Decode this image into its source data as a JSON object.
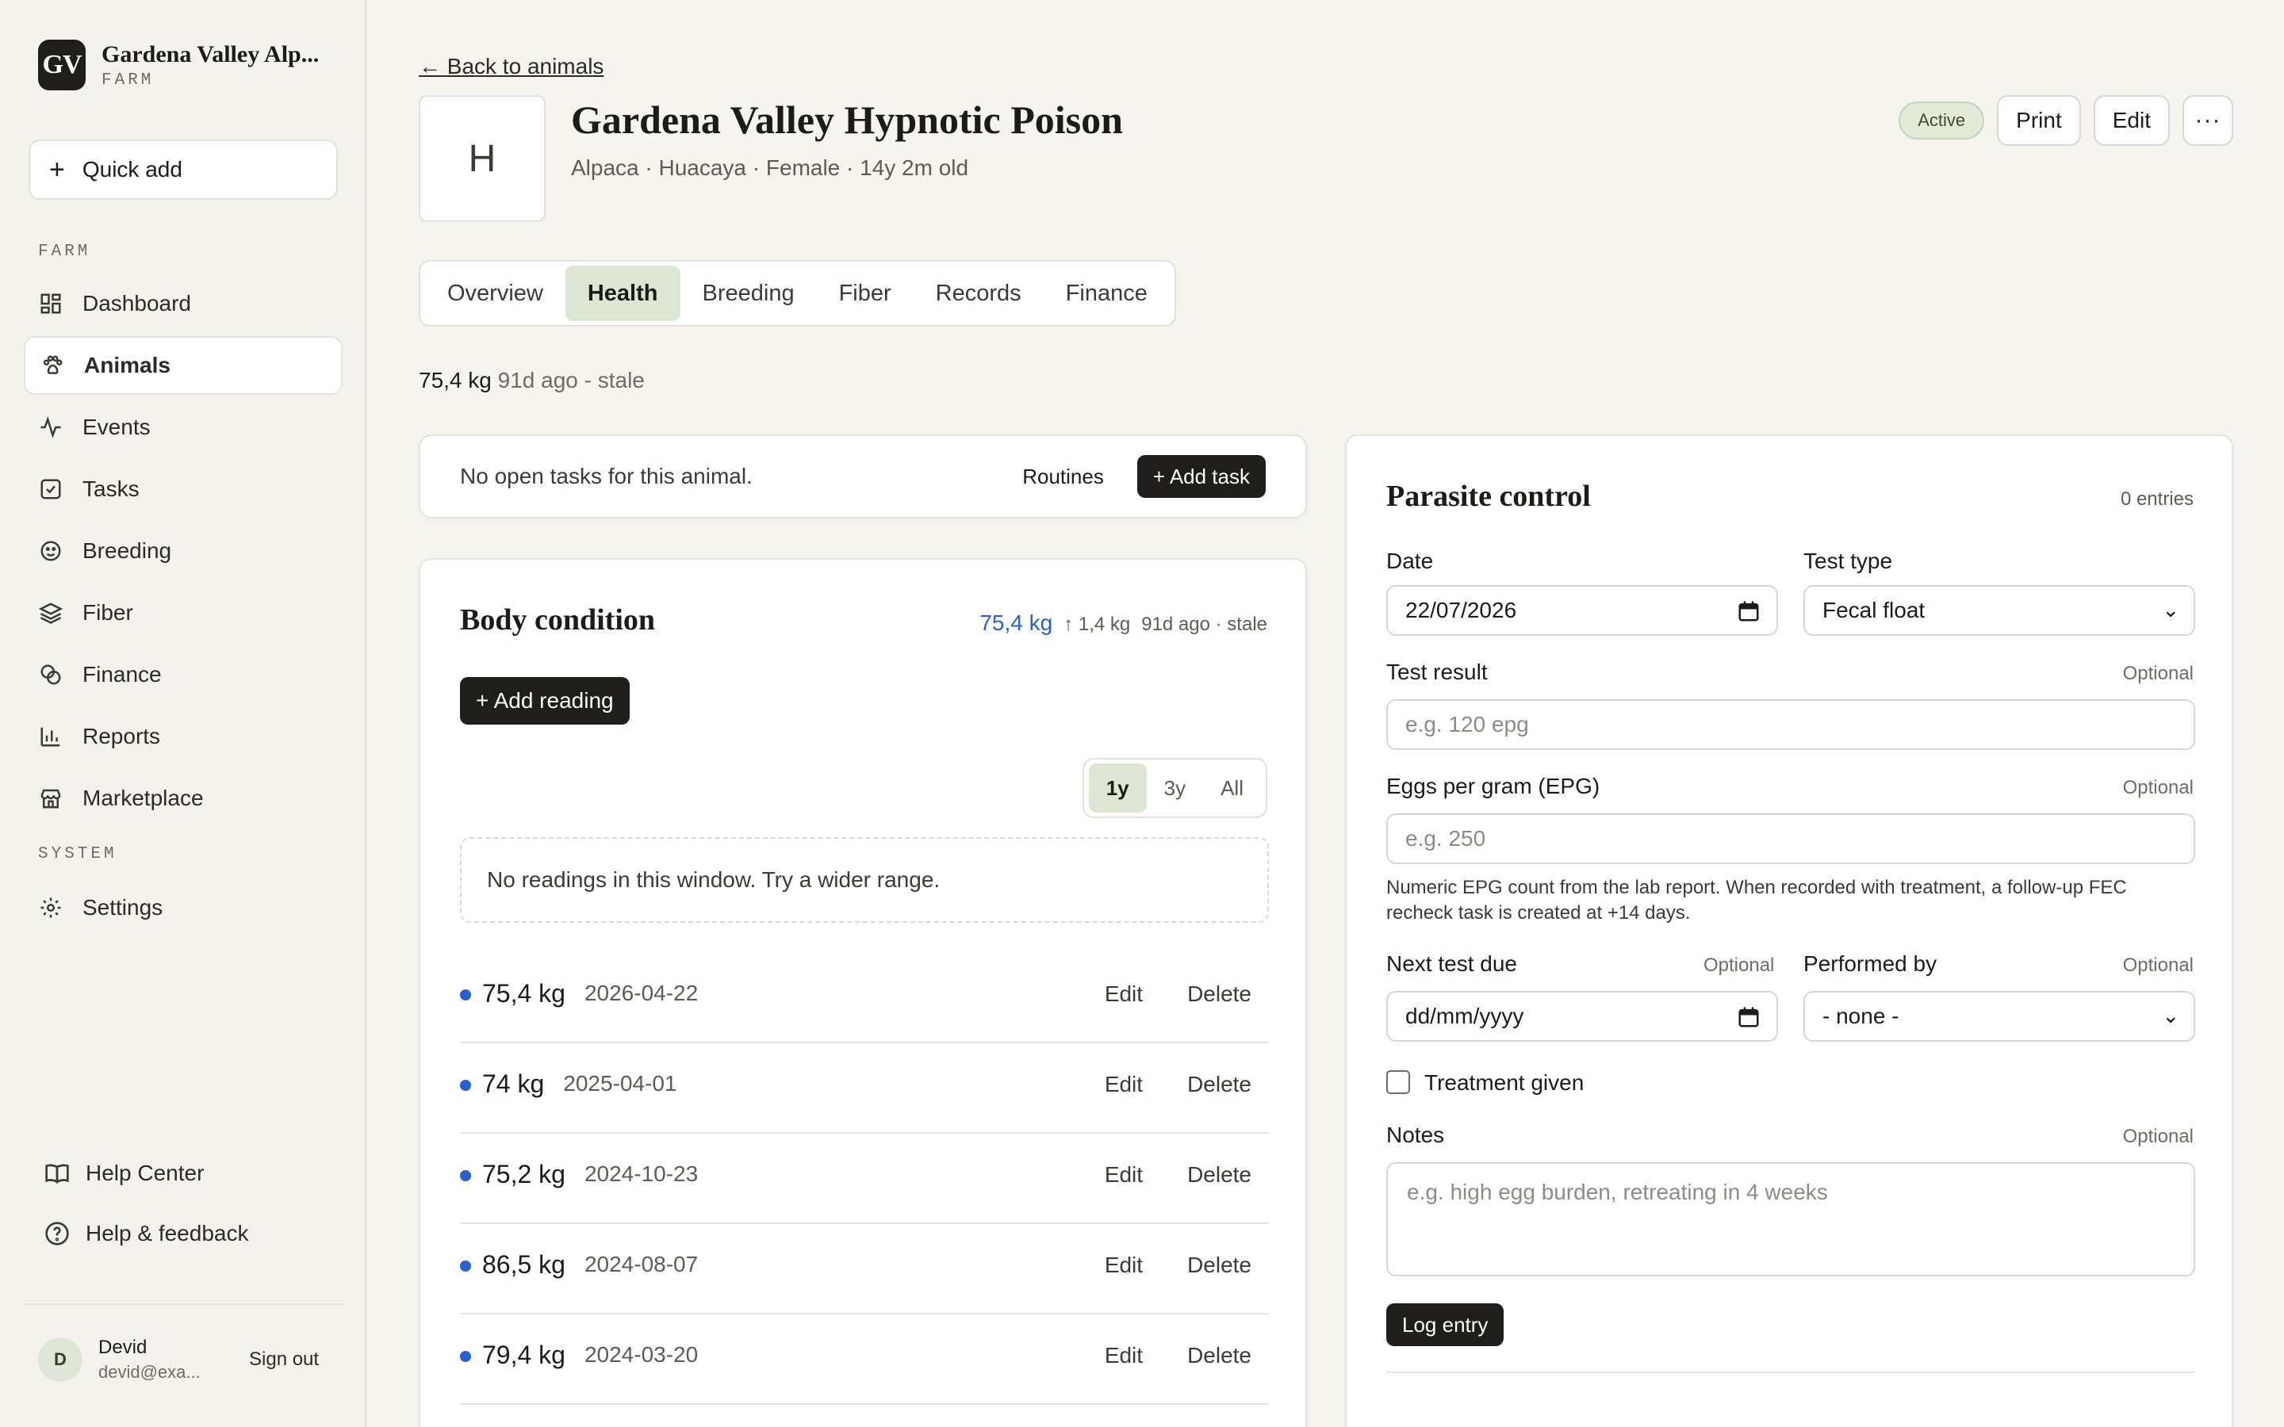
{
  "brand": {
    "logo": "GV",
    "name": "Gardena Valley Alp...",
    "subtitle": "FARM"
  },
  "sidebar": {
    "quick_add": "Quick add",
    "section_farm": "FARM",
    "items": [
      {
        "label": "Dashboard",
        "icon": "dashboard-icon"
      },
      {
        "label": "Animals",
        "icon": "paw-icon",
        "active": true
      },
      {
        "label": "Events",
        "icon": "activity-icon"
      },
      {
        "label": "Tasks",
        "icon": "checkbox-icon"
      },
      {
        "label": "Breeding",
        "icon": "breeding-icon"
      },
      {
        "label": "Fiber",
        "icon": "layers-icon"
      },
      {
        "label": "Finance",
        "icon": "coins-icon"
      },
      {
        "label": "Reports",
        "icon": "bar-chart-icon"
      },
      {
        "label": "Marketplace",
        "icon": "store-icon"
      }
    ],
    "section_system": "SYSTEM",
    "settings": "Settings",
    "help_center": "Help Center",
    "help_feedback": "Help & feedback",
    "user": {
      "initial": "D",
      "name": "Devid",
      "email": "devid@exa...",
      "sign_out": "Sign out"
    }
  },
  "header": {
    "back": "← Back to animals",
    "avatar_letter": "H",
    "name": "Gardena Valley Hypnotic Poison",
    "meta": "Alpaca · Huacaya · Female · 14y 2m old",
    "status": "Active",
    "print": "Print",
    "edit": "Edit",
    "more": "···"
  },
  "tabs": [
    "Overview",
    "Health",
    "Breeding",
    "Fiber",
    "Records",
    "Finance"
  ],
  "active_tab": "Health",
  "weight_summary": {
    "value": "75,4 kg",
    "note": "91d ago - stale"
  },
  "tasks": {
    "empty": "No open tasks for this animal.",
    "routines": "Routines",
    "add_task": "+ Add task"
  },
  "body_condition": {
    "title": "Body condition",
    "latest": "75,4 kg",
    "delta": "↑ 1,4 kg",
    "age": "91d ago · stale",
    "add_reading": "+ Add reading",
    "ranges": [
      "1y",
      "3y",
      "All"
    ],
    "active_range": "1y",
    "empty_window": "No readings in this window. Try a wider range.",
    "edit_label": "Edit",
    "delete_label": "Delete",
    "readings": [
      {
        "kg": "75,4 kg",
        "date": "2026-04-22"
      },
      {
        "kg": "74 kg",
        "date": "2025-04-01"
      },
      {
        "kg": "75,2 kg",
        "date": "2024-10-23"
      },
      {
        "kg": "86,5 kg",
        "date": "2024-08-07"
      },
      {
        "kg": "79,4 kg",
        "date": "2024-03-20"
      }
    ]
  },
  "parasite": {
    "title": "Parasite control",
    "count": "0 entries",
    "date_label": "Date",
    "date_value": "22/07/2026",
    "test_type_label": "Test type",
    "test_type_value": "Fecal float",
    "result_label": "Test result",
    "result_placeholder": "e.g. 120 epg",
    "epg_label": "Eggs per gram (EPG)",
    "epg_placeholder": "e.g. 250",
    "optional": "Optional",
    "help": "Numeric EPG count from the lab report. When recorded with treatment, a follow-up FEC recheck task is created at +14 days.",
    "next_label": "Next test due",
    "next_placeholder": "dd/mm/yyyy",
    "performed_label": "Performed by",
    "performed_value": "- none -",
    "treatment_label": "Treatment given",
    "notes_label": "Notes",
    "notes_placeholder": "e.g. high egg burden, retreating in 4 weeks",
    "log_entry": "Log entry"
  },
  "colors": {
    "accent_blue": "#2461d6",
    "active_tab_bg": "#dde6d5",
    "dark_button": "#1f1e1a",
    "status_bg": "#e3ead9"
  }
}
